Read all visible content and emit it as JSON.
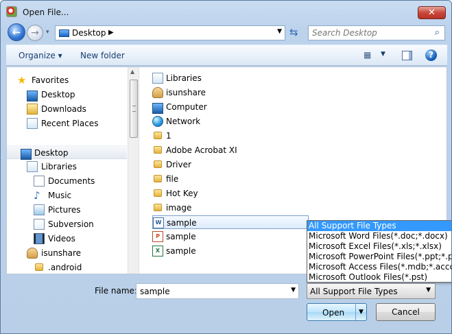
{
  "window": {
    "title": "Open File...",
    "close_label": "✕"
  },
  "navigation": {
    "back_symbol": "←",
    "forward_symbol": "→",
    "recent_symbol": "▾",
    "address": "Desktop",
    "breadcrumb_symbol": "▶",
    "address_dropdown_symbol": "▼",
    "refresh_symbol": "⇆",
    "search_placeholder": "Search Desktop",
    "search_symbol": "⌕"
  },
  "toolbar": {
    "organize": "Organize ▾",
    "new_folder": "New folder",
    "view_symbol": "▦",
    "view_dropdown_symbol": "▼",
    "help_symbol": "?"
  },
  "sidebar": {
    "items": [
      {
        "label": "Favorites",
        "icon": "star-icon"
      },
      {
        "label": "Desktop",
        "icon": "desktop-icon"
      },
      {
        "label": "Downloads",
        "icon": "downloads-icon"
      },
      {
        "label": "Recent Places",
        "icon": "recent-places-icon"
      },
      {
        "label": "Desktop",
        "icon": "desktop-icon"
      },
      {
        "label": "Libraries",
        "icon": "libraries-icon"
      },
      {
        "label": "Documents",
        "icon": "documents-icon"
      },
      {
        "label": "Music",
        "icon": "music-icon"
      },
      {
        "label": "Pictures",
        "icon": "pictures-icon"
      },
      {
        "label": "Subversion",
        "icon": "subversion-icon"
      },
      {
        "label": "Videos",
        "icon": "videos-icon"
      },
      {
        "label": "isunshare",
        "icon": "user-folder-icon"
      },
      {
        "label": ".android",
        "icon": "folder-icon"
      }
    ]
  },
  "files": [
    {
      "label": "Libraries",
      "icon": "libraries-icon"
    },
    {
      "label": "isunshare",
      "icon": "user-folder-icon"
    },
    {
      "label": "Computer",
      "icon": "computer-icon"
    },
    {
      "label": "Network",
      "icon": "network-icon"
    },
    {
      "label": "1",
      "icon": "folder-icon"
    },
    {
      "label": "Adobe Acrobat XI",
      "icon": "folder-icon"
    },
    {
      "label": "Driver",
      "icon": "folder-icon"
    },
    {
      "label": "file",
      "icon": "folder-icon"
    },
    {
      "label": "Hot Key",
      "icon": "folder-icon"
    },
    {
      "label": "image",
      "icon": "folder-icon"
    },
    {
      "label": "sample",
      "icon": "word-document-icon"
    },
    {
      "label": "sample",
      "icon": "powerpoint-document-icon"
    },
    {
      "label": "sample",
      "icon": "excel-document-icon"
    }
  ],
  "bottom": {
    "file_name_label": "File name:",
    "file_name_value": "sample",
    "file_name_dropdown_symbol": "▼",
    "selected_filter": "All Support File Types",
    "filter_dropdown_symbol": "▼",
    "open_label": "Open",
    "open_dropdown_symbol": "▼",
    "cancel_label": "Cancel"
  },
  "dropdown_options": [
    "All Support File Types",
    "Microsoft Word Files(*.doc;*.docx)",
    "Microsoft Excel Files(*.xls;*.xlsx)",
    "Microsoft PowerPoint Files(*.ppt;*.pptx)",
    "Microsoft Access Files(*.mdb;*.accdb)",
    "Microsoft Outlook Files(*.pst)"
  ]
}
